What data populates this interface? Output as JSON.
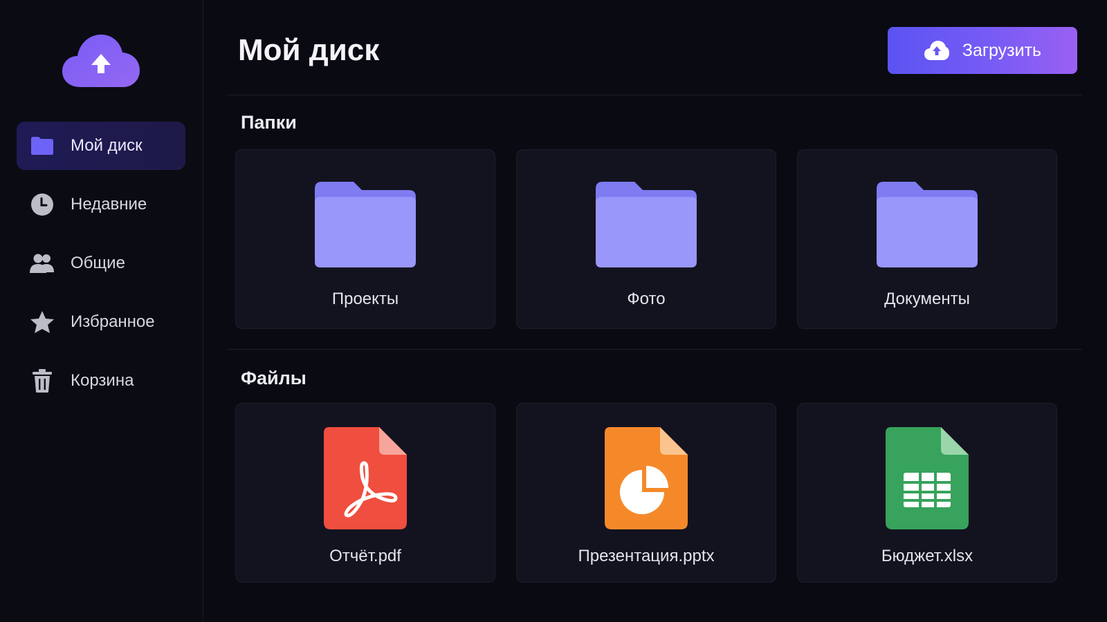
{
  "colors": {
    "accent": "#6b5cf5",
    "folder": "#9a97fb",
    "folder_tab": "#7f7cf2",
    "pdf": "#f04e3e",
    "pptx": "#f5892a",
    "xlsx": "#37a35c"
  },
  "sidebar": {
    "logo_icon": "cloud-upload-icon",
    "items": [
      {
        "label": "Мой диск",
        "icon": "folder-icon",
        "active": true
      },
      {
        "label": "Недавние",
        "icon": "clock-icon",
        "active": false
      },
      {
        "label": "Общие",
        "icon": "users-icon",
        "active": false
      },
      {
        "label": "Избранное",
        "icon": "star-icon",
        "active": false
      },
      {
        "label": "Корзина",
        "icon": "trash-icon",
        "active": false
      }
    ]
  },
  "header": {
    "title": "Мой диск",
    "upload_label": "Загрузить",
    "upload_icon": "cloud-upload-icon"
  },
  "folders": {
    "title": "Папки",
    "items": [
      {
        "name": "Проекты",
        "icon": "folder-icon"
      },
      {
        "name": "Фото",
        "icon": "folder-icon"
      },
      {
        "name": "Документы",
        "icon": "folder-icon"
      }
    ]
  },
  "files": {
    "title": "Файлы",
    "items": [
      {
        "name": "Отчёт.pdf",
        "icon": "pdf-file-icon"
      },
      {
        "name": "Презентация.pptx",
        "icon": "pptx-file-icon"
      },
      {
        "name": "Бюджет.xlsx",
        "icon": "xlsx-file-icon"
      }
    ]
  }
}
